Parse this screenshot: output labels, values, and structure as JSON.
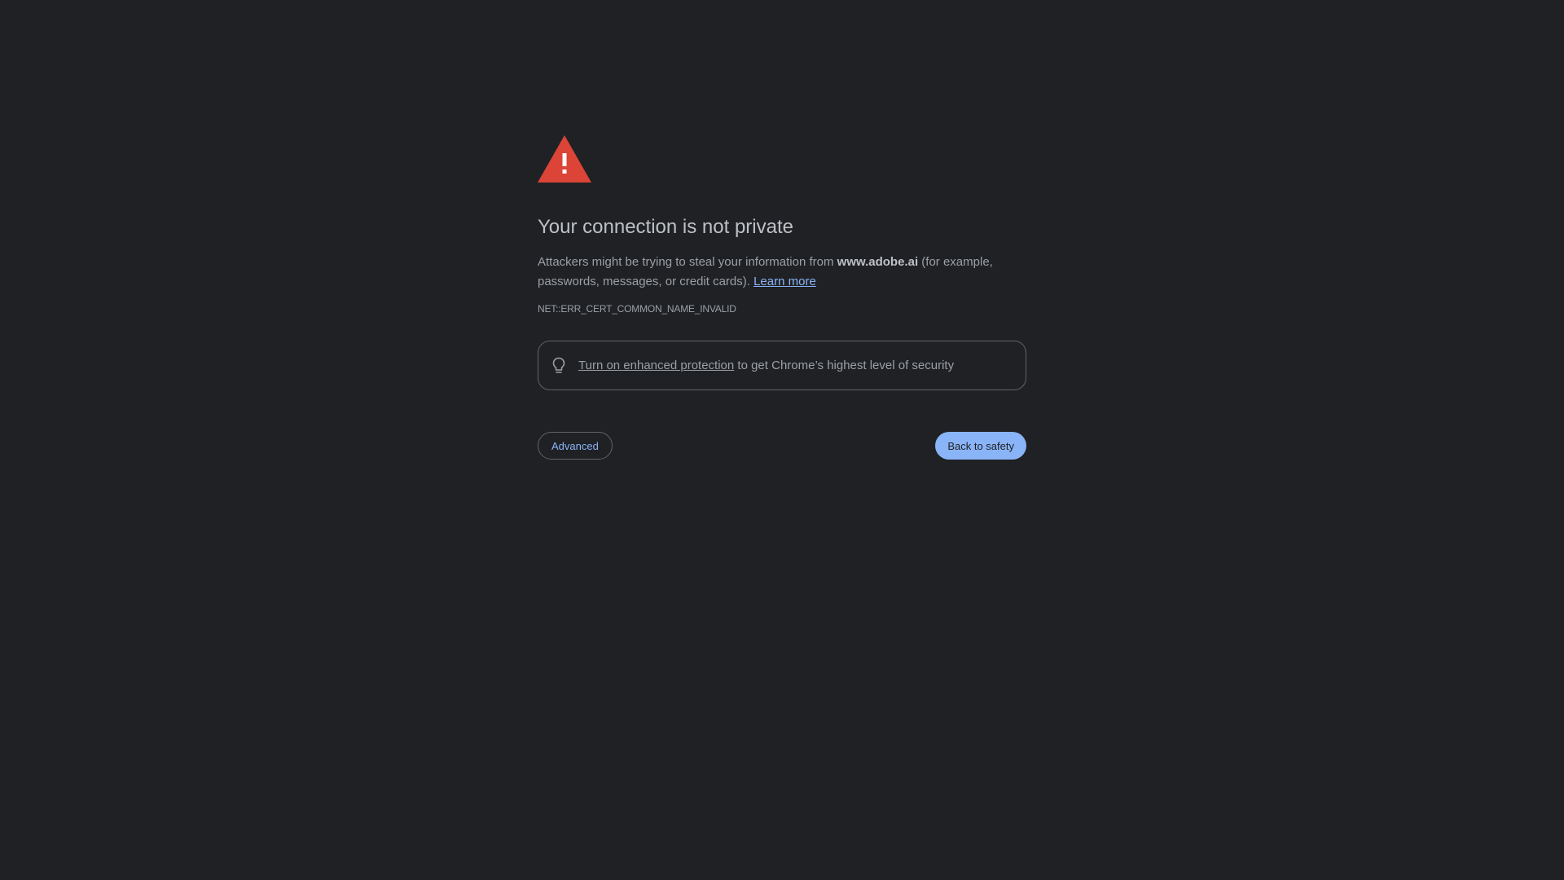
{
  "interstitial": {
    "title": "Your connection is not private",
    "message_prefix": "Attackers might be trying to steal your information from ",
    "domain": "www.adobe.ai",
    "message_suffix": " (for example, passwords, messages, or credit cards). ",
    "learn_more_label": "Learn more",
    "error_code": "NET::ERR_CERT_COMMON_NAME_INVALID"
  },
  "enhanced_protection": {
    "link_label": "Turn on enhanced protection",
    "text_suffix": " to get Chrome’s highest level of security"
  },
  "buttons": {
    "advanced_label": "Advanced",
    "back_label": "Back to safety"
  },
  "colors": {
    "background": "#202124",
    "warning_red": "#db4437",
    "link_blue": "#8ab4f8",
    "text_primary": "#bdc1c6",
    "text_secondary": "#9aa0a6"
  },
  "icons": {
    "warning": "warning-triangle-icon",
    "bulb": "lightbulb-icon"
  }
}
